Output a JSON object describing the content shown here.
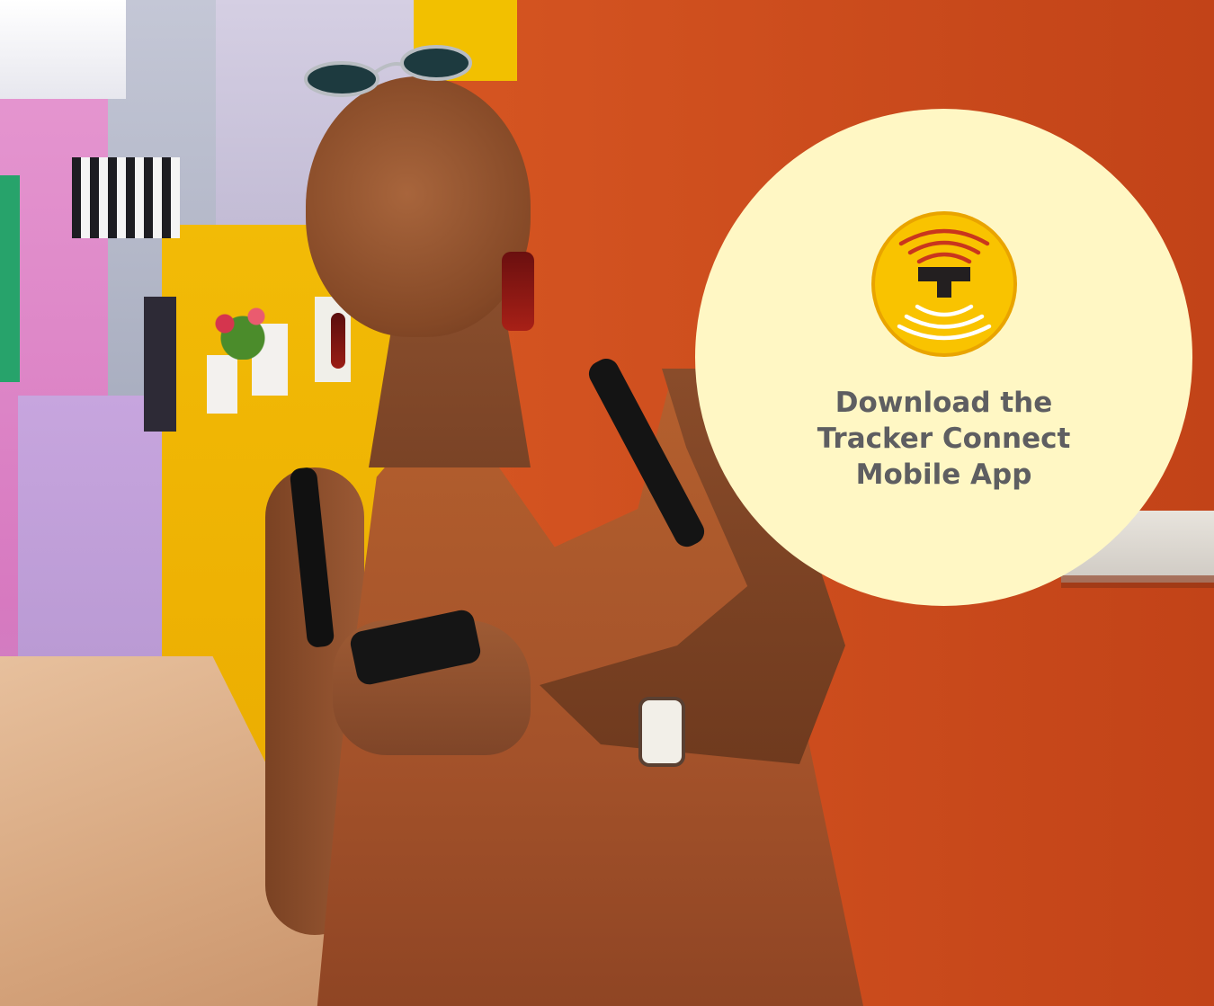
{
  "promo": {
    "line1": "Download the",
    "line2": "Tracker Connect",
    "line3": "Mobile App"
  },
  "logo": {
    "icon": "tracker-t-logo-icon",
    "letter": "T",
    "colors": {
      "badge": "#f9c300",
      "ring": "#e9a400",
      "letter": "#231f20",
      "signal_top": "#c9361d",
      "signal_bottom": "#ffffff"
    }
  },
  "colors": {
    "circle_fill": "#fff7c4",
    "text": "#5e5e61",
    "wall": "#c84a1d"
  }
}
